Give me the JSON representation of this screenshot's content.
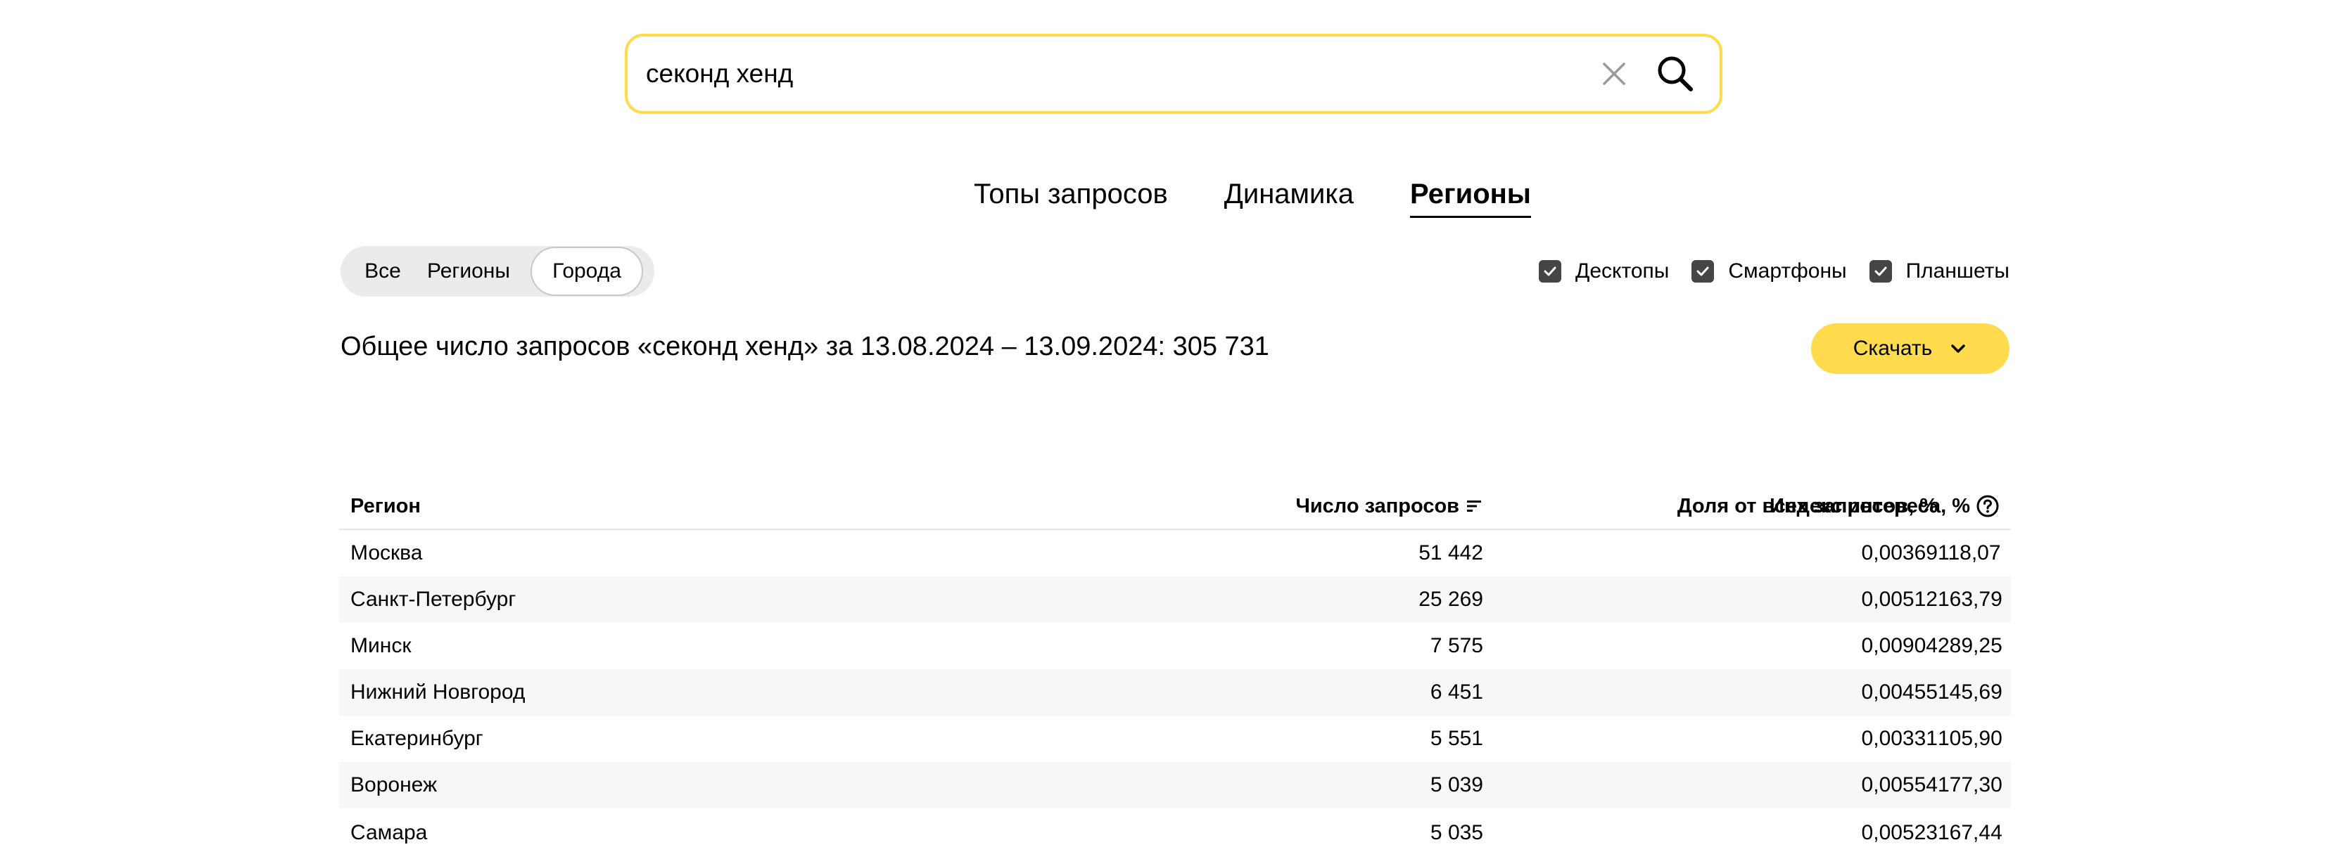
{
  "search": {
    "value": "секонд хенд",
    "clear_icon": "close-icon",
    "submit_icon": "search-icon"
  },
  "tabs": [
    {
      "label": "Топы запросов",
      "active": false
    },
    {
      "label": "Динамика",
      "active": false
    },
    {
      "label": "Регионы",
      "active": true
    }
  ],
  "filter": {
    "all": "Все",
    "regions": "Регионы",
    "cities": "Города",
    "selected": "cities"
  },
  "devices": [
    {
      "label": "Десктопы",
      "checked": true
    },
    {
      "label": "Смартфоны",
      "checked": true
    },
    {
      "label": "Планшеты",
      "checked": true
    }
  ],
  "summary": "Общее число запросов «секонд хенд» за 13.08.2024 – 13.09.2024: 305 731",
  "download": {
    "label": "Скачать",
    "icon": "chevron-down-icon"
  },
  "table": {
    "headers": {
      "region": "Регион",
      "count": "Число запросов",
      "share": "Доля от всех запросов, %",
      "index": "Индекс интереса, %"
    },
    "rows": [
      {
        "region": "Москва",
        "count": "51 442",
        "share": "0,00369",
        "index": "118,07"
      },
      {
        "region": "Санкт-Петербург",
        "count": "25 269",
        "share": "0,00512",
        "index": "163,79"
      },
      {
        "region": "Минск",
        "count": "7 575",
        "share": "0,00904",
        "index": "289,25"
      },
      {
        "region": "Нижний Новгород",
        "count": "6 451",
        "share": "0,00455",
        "index": "145,69"
      },
      {
        "region": "Екатеринбург",
        "count": "5 551",
        "share": "0,00331",
        "index": "105,90"
      },
      {
        "region": "Воронеж",
        "count": "5 039",
        "share": "0,00554",
        "index": "177,30"
      },
      {
        "region": "Самара",
        "count": "5 035",
        "share": "0,00523",
        "index": "167,44"
      }
    ]
  },
  "colors": {
    "accent": "#ffdb4d",
    "checkbox": "#454545",
    "segment_bg": "#ebebeb",
    "row_alt": "#f7f7f7"
  }
}
